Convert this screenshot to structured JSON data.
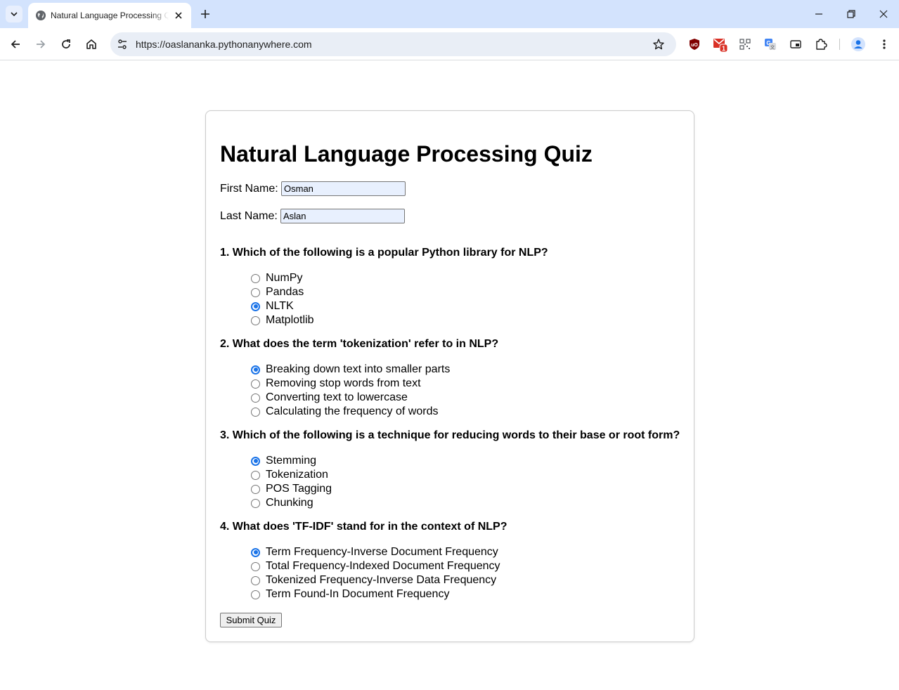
{
  "browser": {
    "tab_title": "Natural Language Processing Quiz",
    "url": "https://oaslananka.pythonanywhere.com",
    "gmail_badge": "1"
  },
  "quiz": {
    "title": "Natural Language Processing Quiz",
    "first_name_label": "First Name:",
    "first_name_value": "Osman",
    "last_name_label": "Last Name:",
    "last_name_value": "Aslan",
    "questions": [
      {
        "text": "1. Which of the following is a popular Python library for NLP?",
        "options": [
          "NumPy",
          "Pandas",
          "NLTK",
          "Matplotlib"
        ],
        "selected": 2
      },
      {
        "text": "2. What does the term 'tokenization' refer to in NLP?",
        "options": [
          "Breaking down text into smaller parts",
          "Removing stop words from text",
          "Converting text to lowercase",
          "Calculating the frequency of words"
        ],
        "selected": 0
      },
      {
        "text": "3. Which of the following is a technique for reducing words to their base or root form?",
        "options": [
          "Stemming",
          "Tokenization",
          "POS Tagging",
          "Chunking"
        ],
        "selected": 0
      },
      {
        "text": "4. What does 'TF-IDF' stand for in the context of NLP?",
        "options": [
          "Term Frequency-Inverse Document Frequency",
          "Total Frequency-Indexed Document Frequency",
          "Tokenized Frequency-Inverse Data Frequency",
          "Term Found-In Document Frequency"
        ],
        "selected": 0
      }
    ],
    "submit_label": "Submit Quiz"
  },
  "colors": {
    "accent": "#1a73e8",
    "tabbar": "#d3e3fd",
    "omnibox": "#e9eef6",
    "autofill": "#e8f0fe"
  }
}
